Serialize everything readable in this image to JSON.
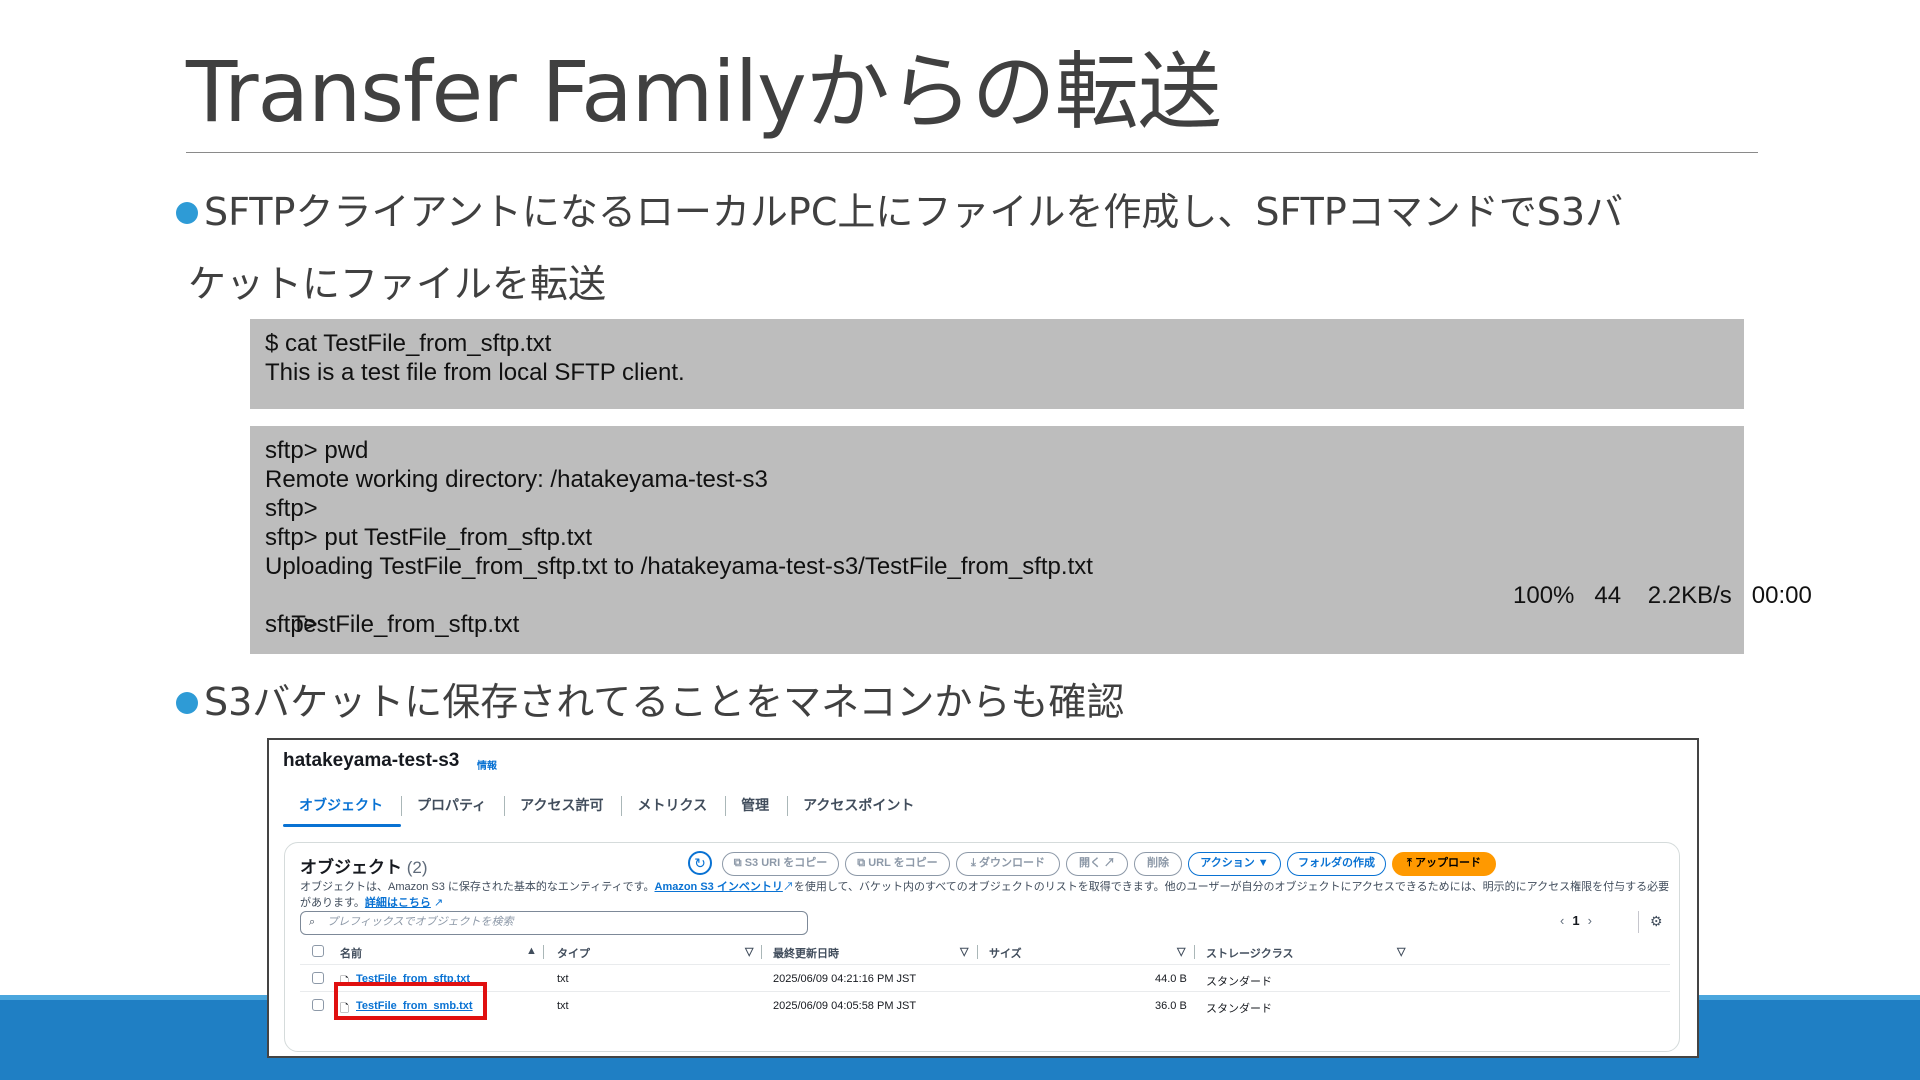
{
  "slide": {
    "title": "Transfer Familyからの転送",
    "bullet1_line1": "SFTPクライアントになるローカルPC上にファイルを作成し、SFTPコマンドでS3バ",
    "bullet1_line2": "ケットにファイルを転送",
    "bullet2": "S3バケットに保存されてることをマネコンからも確認",
    "colors": {
      "bullet": "#2e9bd6",
      "bottom_band": "#1f7fc4",
      "code_bg": "#bdbdbd"
    }
  },
  "code1": {
    "lines": [
      "$ cat TestFile_from_sftp.txt",
      "This is a test file from local SFTP client."
    ]
  },
  "code2": {
    "lines": [
      "sftp> pwd",
      "Remote working directory: /hatakeyama-test-s3",
      "sftp>",
      "sftp> put TestFile_from_sftp.txt",
      "Uploading TestFile_from_sftp.txt to /hatakeyama-test-s3/TestFile_from_sftp.txt",
      "TestFile_from_sftp.txt",
      "sftp>"
    ],
    "progress": "100%   44    2.2KB/s   00:00"
  },
  "console": {
    "bucket_name": "hatakeyama-test-s3",
    "info": "情報",
    "tabs": [
      "オブジェクト",
      "プロパティ",
      "アクセス許可",
      "メトリクス",
      "管理",
      "アクセスポイント"
    ],
    "panel_title": "オブジェクト",
    "panel_count": "(2)",
    "buttons": {
      "copy_s3_uri": "S3 URI をコピー",
      "copy_url": "URL をコピー",
      "download": "ダウンロード",
      "open": "開く",
      "delete": "削除",
      "actions": "アクション ▼",
      "create_folder": "フォルダの作成",
      "upload": "アップロード"
    },
    "desc_part1": "オブジェクトは、Amazon S3 に保存された基本的なエンティティです。",
    "desc_link1": "Amazon S3 インベントリ",
    "desc_part2": "を使用して、バケット内のすべてのオブジェクトのリストを取得できます。他のユーザーが自分のオブジェクトにアクセスできるためには、明示的にアクセス権限を付与する必要があります。",
    "desc_link2": "詳細はこちら",
    "search_placeholder": "プレフィックスでオブジェクトを検索",
    "page_number": "1",
    "columns": [
      "名前",
      "タイプ",
      "最終更新日時",
      "サイズ",
      "ストレージクラス"
    ],
    "rows": [
      {
        "name": "TestFile_from_sftp.txt",
        "type": "txt",
        "modified": "2025/06/09 04:21:16 PM JST",
        "size": "44.0 B",
        "storage": "スタンダード"
      },
      {
        "name": "TestFile_from_smb.txt",
        "type": "txt",
        "modified": "2025/06/09 04:05:58 PM JST",
        "size": "36.0 B",
        "storage": "スタンダード"
      }
    ]
  }
}
